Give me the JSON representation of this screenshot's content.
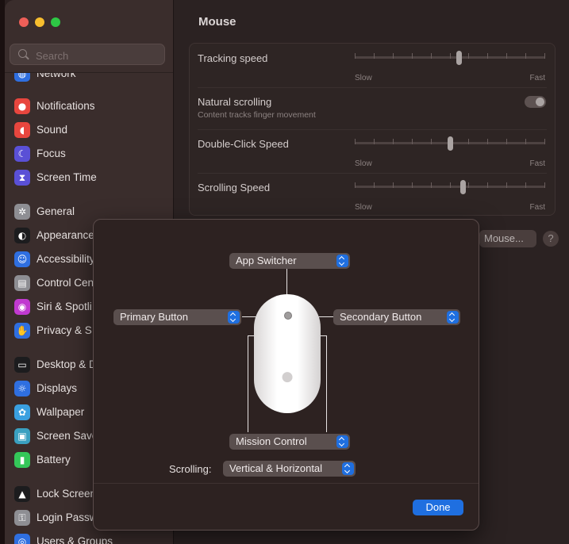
{
  "sidebar": {
    "search_placeholder": "Search",
    "items": [
      {
        "label": "Network",
        "icon": "globe-icon",
        "color": "#2f6fe0"
      },
      {
        "label": "Notifications",
        "icon": "bell-icon",
        "color": "#e8463e"
      },
      {
        "label": "Sound",
        "icon": "speaker-icon",
        "color": "#e8463e"
      },
      {
        "label": "Focus",
        "icon": "moon-icon",
        "color": "#5a50d6"
      },
      {
        "label": "Screen Time",
        "icon": "hourglass-icon",
        "color": "#5a50d6"
      },
      {
        "label": "General",
        "icon": "gear-icon",
        "color": "#8e8e93"
      },
      {
        "label": "Appearance",
        "icon": "appearance-icon",
        "color": "#1c1c1e"
      },
      {
        "label": "Accessibility",
        "icon": "accessibility-icon",
        "color": "#2f6fe0"
      },
      {
        "label": "Control Cen",
        "icon": "control-center-icon",
        "color": "#8e8e93"
      },
      {
        "label": "Siri & Spotli",
        "icon": "siri-icon",
        "color": "#c13ad0"
      },
      {
        "label": "Privacy & S",
        "icon": "hand-icon",
        "color": "#2f6fe0"
      },
      {
        "label": "Desktop & D",
        "icon": "desktop-icon",
        "color": "#1c1c1e"
      },
      {
        "label": "Displays",
        "icon": "sun-icon",
        "color": "#2f6fe0"
      },
      {
        "label": "Wallpaper",
        "icon": "flower-icon",
        "color": "#3aa0e0"
      },
      {
        "label": "Screen Save",
        "icon": "screensaver-icon",
        "color": "#3aa0c0"
      },
      {
        "label": "Battery",
        "icon": "battery-icon",
        "color": "#34c759"
      },
      {
        "label": "Lock Screen",
        "icon": "lock-icon",
        "color": "#1c1c1e"
      },
      {
        "label": "Login Passw",
        "icon": "key-icon",
        "color": "#8e8e93"
      },
      {
        "label": "Users & Groups",
        "icon": "users-icon",
        "color": "#2f6fe0"
      }
    ]
  },
  "main": {
    "title": "Mouse",
    "tracking_label": "Tracking speed",
    "tracking_min": "Slow",
    "tracking_max": "Fast",
    "tracking_value": 0.55,
    "natural_label": "Natural scrolling",
    "natural_sub": "Content tracks finger movement",
    "natural_on": false,
    "doubleclick_label": "Double-Click Speed",
    "doubleclick_min": "Slow",
    "doubleclick_max": "Fast",
    "doubleclick_value": 0.5,
    "scroll_label": "Scrolling Speed",
    "scroll_min": "Slow",
    "scroll_max": "Fast",
    "scroll_value": 0.57,
    "setup_button": "Mouse...",
    "help_button": "?"
  },
  "dialog": {
    "top_button": "App Switcher",
    "primary_button": "Primary Button",
    "secondary_button": "Secondary Button",
    "bottom_button": "Mission Control",
    "scrolling_label": "Scrolling:",
    "scrolling_value": "Vertical & Horizontal",
    "done": "Done",
    "accent": "#1f6fe0"
  }
}
